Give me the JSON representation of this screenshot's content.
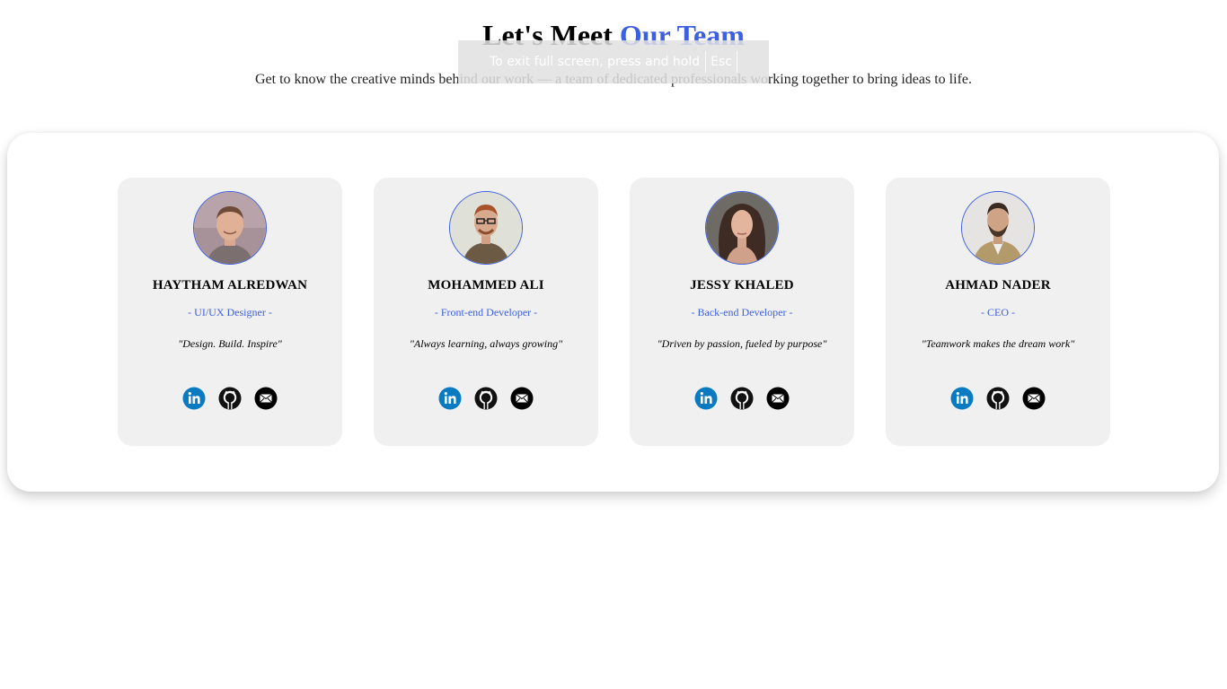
{
  "header": {
    "title_main": "Let's Meet ",
    "title_accent": "Our Team",
    "subtitle": "Get to know the creative minds behind our work — a team of dedicated professionals working together to bring ideas to life."
  },
  "fullscreen_toast": {
    "text": "To exit full screen, press and hold",
    "key": "Esc"
  },
  "colors": {
    "accent": "#3d5fe0",
    "card_bg": "#f0f0f0",
    "linkedin": "#0a7bc1"
  },
  "team": [
    {
      "name": "HAYTHAM ALREDWAN",
      "role": "- UI/UX Designer -",
      "quote": "\"Design. Build. Inspire\"",
      "icons": [
        "linkedin-icon",
        "github-icon",
        "email-icon"
      ]
    },
    {
      "name": "MOHAMMED ALI",
      "role": "- Front-end Developer -",
      "quote": "\"Always learning, always growing\"",
      "icons": [
        "linkedin-icon",
        "github-icon",
        "email-icon"
      ]
    },
    {
      "name": "JESSY KHALED",
      "role": "- Back-end Developer -",
      "quote": "\"Driven by passion, fueled by purpose\"",
      "icons": [
        "linkedin-icon",
        "github-icon",
        "email-icon"
      ]
    },
    {
      "name": "AHMAD NADER",
      "role": "- CEO -",
      "quote": "\"Teamwork makes the dream work\"",
      "icons": [
        "linkedin-icon",
        "github-icon",
        "email-icon"
      ]
    }
  ]
}
